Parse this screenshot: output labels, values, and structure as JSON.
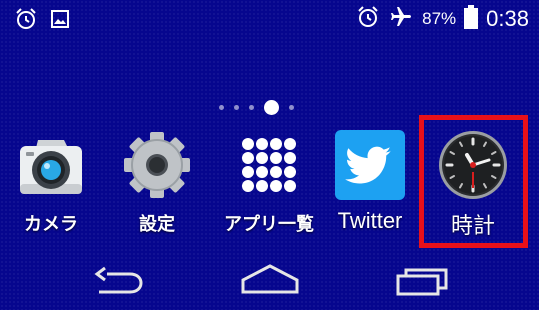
{
  "status_bar": {
    "left_icons": [
      "alarm-clock-icon",
      "image-notification-icon"
    ],
    "right_icons": [
      "alarm-clock-icon",
      "airplane-mode-icon",
      "battery-icon"
    ],
    "battery_percent": "87%",
    "time": "0:38"
  },
  "home": {
    "page_indicator": {
      "pages": 5,
      "current": 4
    }
  },
  "dock": {
    "apps": [
      {
        "label": "カメラ",
        "icon": "camera-icon"
      },
      {
        "label": "設定",
        "icon": "settings-gear-icon"
      },
      {
        "label": "アプリ一覧",
        "icon": "app-drawer-grid-icon"
      },
      {
        "label": "Twitter",
        "icon": "twitter-bird-icon"
      },
      {
        "label": "時計",
        "icon": "analog-clock-icon"
      }
    ],
    "highlighted_app": "時計",
    "highlight_color": "#e8101a"
  },
  "navigation_bar": {
    "buttons": [
      "back-icon",
      "home-icon",
      "recent-apps-icon"
    ]
  },
  "colors": {
    "wallpaper": "#06068e",
    "twitter_blue": "#1da1f2"
  }
}
